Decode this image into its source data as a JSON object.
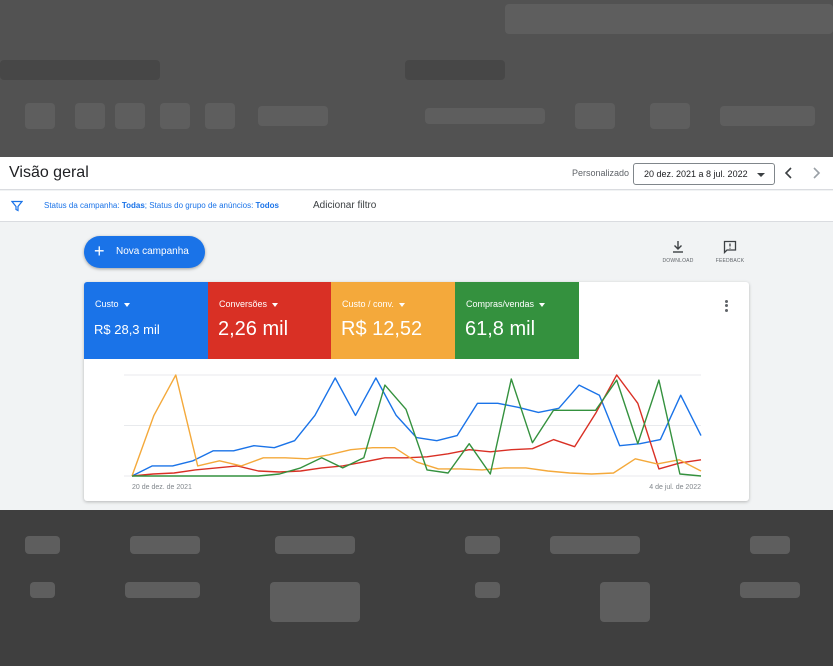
{
  "header": {
    "title": "Visão geral",
    "custom_label": "Personalizado",
    "date_range": "20 dez. 2021 a 8 jul. 2022"
  },
  "filters": {
    "prefix1": "Status da campanha: ",
    "value1": "Todas",
    "prefix2": "; Status do grupo de anúncios: ",
    "value2": "Todos",
    "add_filter": "Adicionar filtro"
  },
  "toolbar": {
    "new_campaign": "Nova campanha",
    "download": "DOWNLOAD",
    "feedback": "FEEDBACK"
  },
  "metrics": [
    {
      "name": "Custo",
      "value": "R$ 28,3 mil",
      "color": "#1a73e8"
    },
    {
      "name": "Conversões",
      "value": "2,26 mil",
      "color": "#d93025"
    },
    {
      "name": "Custo / conv.",
      "value": "R$ 12,52",
      "color": "#f4a93b"
    },
    {
      "name": "Compras/vendas",
      "value": "61,8 mil",
      "color": "#34913e"
    }
  ],
  "chart_data": {
    "type": "line",
    "x_start_label": "20 de dez. de 2021",
    "x_end_label": "4 de jul. de 2022",
    "grid": true,
    "ylim": [
      0,
      100
    ],
    "series": [
      {
        "name": "Custo",
        "color": "#1a73e8",
        "values": [
          0,
          10,
          10,
          15,
          25,
          25,
          30,
          28,
          35,
          60,
          97,
          60,
          97,
          60,
          38,
          35,
          40,
          72,
          72,
          68,
          63,
          67,
          90,
          80,
          30,
          32,
          36,
          80,
          40
        ]
      },
      {
        "name": "Conversões",
        "color": "#d93025",
        "values": [
          0,
          2,
          3,
          6,
          8,
          10,
          5,
          4,
          5,
          8,
          10,
          14,
          18,
          18,
          19,
          22,
          26,
          24,
          26,
          27,
          36,
          29,
          62,
          100,
          72,
          7,
          13,
          16
        ]
      },
      {
        "name": "Custo / conv.",
        "color": "#f4a93b",
        "values": [
          0,
          60,
          100,
          10,
          15,
          10,
          18,
          18,
          17,
          21,
          26,
          28,
          28,
          14,
          7,
          7,
          6,
          8,
          8,
          5,
          3,
          2,
          3,
          17,
          12,
          16,
          5
        ]
      },
      {
        "name": "Compras/vendas",
        "color": "#34913e",
        "values": [
          0,
          0,
          0,
          0,
          0,
          0,
          0,
          2,
          8,
          18,
          8,
          18,
          90,
          66,
          6,
          3,
          32,
          2,
          96,
          33,
          65,
          65,
          65,
          95,
          32,
          95,
          2,
          0
        ]
      }
    ]
  }
}
